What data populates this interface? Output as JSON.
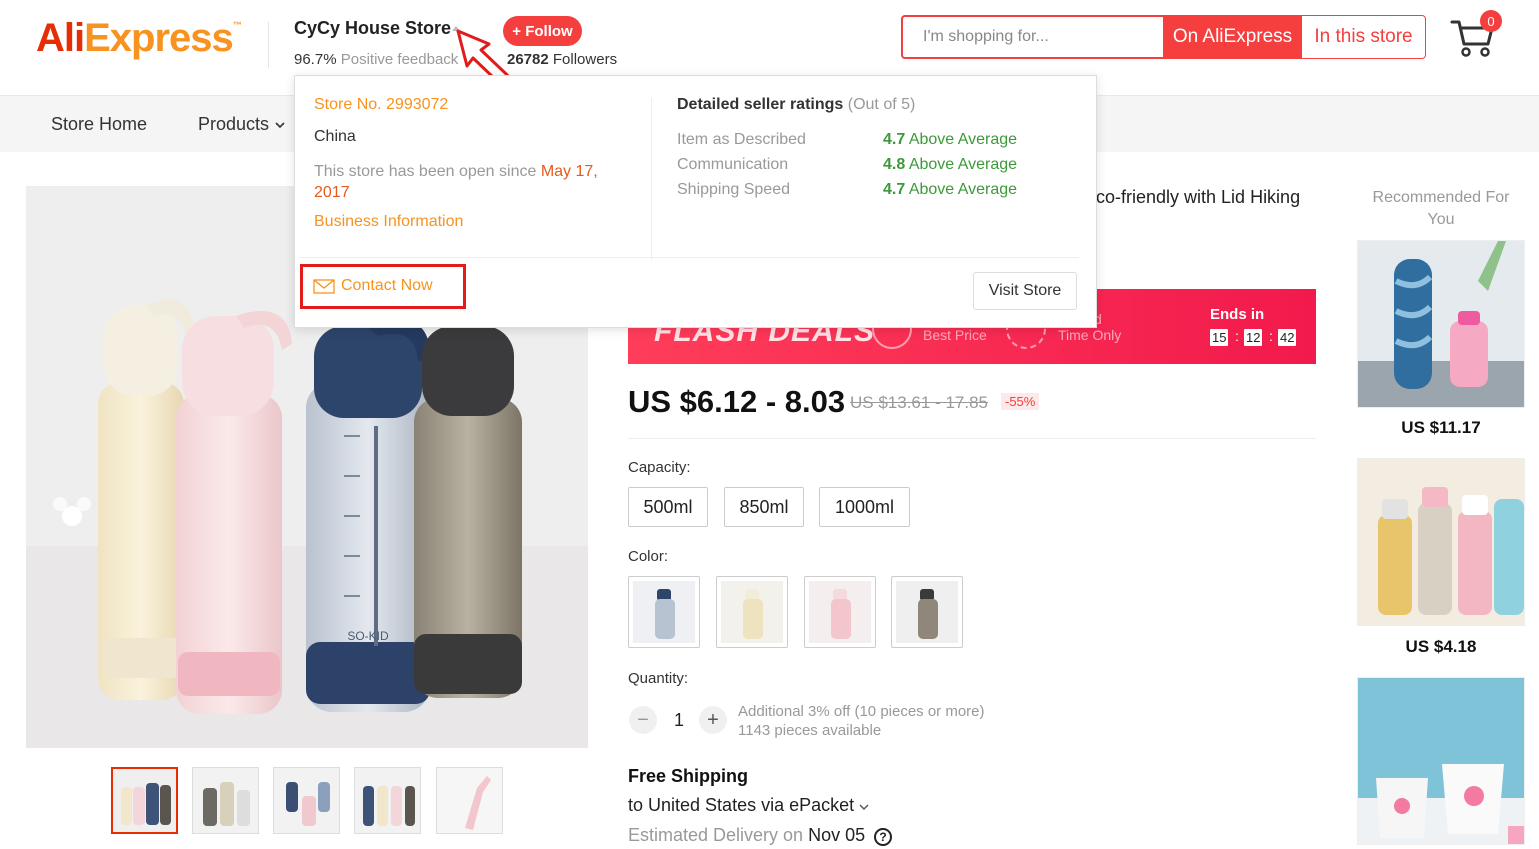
{
  "header": {
    "logo_part1": "Ali",
    "logo_part2": "Express",
    "logo_tm": "™",
    "store_name": "CyCy House Store",
    "feedback_pct": "96.7%",
    "feedback_label": "Positive feedback",
    "follow_label": "+ Follow",
    "followers_count": "26782",
    "followers_label": "Followers",
    "search_placeholder": "I'm shopping for...",
    "search_ali_label": "On AliExpress",
    "search_store_label": "In this store",
    "cart_count": "0"
  },
  "nav": {
    "items": [
      "Store Home",
      "Products"
    ]
  },
  "popup": {
    "store_no": "Store No. 2993072",
    "country": "China",
    "open_since_prefix": "This store has been open since",
    "open_since_date1": "May 17,",
    "open_since_date2": "2017",
    "business_info": "Business Information",
    "ratings_title": "Detailed seller ratings",
    "ratings_scale": "(Out of 5)",
    "ratings": [
      {
        "label": "Item as Described",
        "score": "4.7",
        "level": "Above Average"
      },
      {
        "label": "Communication",
        "score": "4.8",
        "level": "Above Average"
      },
      {
        "label": "Shipping Speed",
        "score": "4.7",
        "level": "Above Average"
      }
    ],
    "contact_label": "Contact Now",
    "visit_label": "Visit Store"
  },
  "product": {
    "title_fragment": "co-friendly with Lid Hiking",
    "bottle_text": "SO-KID",
    "flash": {
      "title": "FLASH DEALS",
      "best_price": "Best Price",
      "limited_frag": "d",
      "time_only": "Time Only",
      "ends_label": "Ends in",
      "hh": "15",
      "mm": "12",
      "ss": "42",
      "colon": ":"
    },
    "price": "US $6.12 - 8.03",
    "old_price": "US $13.61 - 17.85",
    "discount": "-55%",
    "capacity_label": "Capacity:",
    "capacities": [
      "500ml",
      "850ml",
      "1000ml"
    ],
    "color_label": "Color:",
    "quantity_label": "Quantity:",
    "quantity": "1",
    "qty_minus": "−",
    "qty_plus": "+",
    "qty_note1": "Additional 3% off (10 pieces or more)",
    "qty_note2": "1143 pieces available",
    "shipping_title": "Free Shipping",
    "shipping_to": "to United States via ePacket",
    "estimated_prefix": "Estimated Delivery on",
    "estimated_date": "Nov 05",
    "help_glyph": "?"
  },
  "recommended": {
    "title": "Recommended For You",
    "items": [
      {
        "price": "US $11.17"
      },
      {
        "price": "US $4.18"
      }
    ]
  },
  "colors": {
    "accent": "#f53e3e",
    "brand_orange": "#f7931e",
    "rating_green": "#3d9a3a",
    "flash_red": "#f21a4c"
  }
}
